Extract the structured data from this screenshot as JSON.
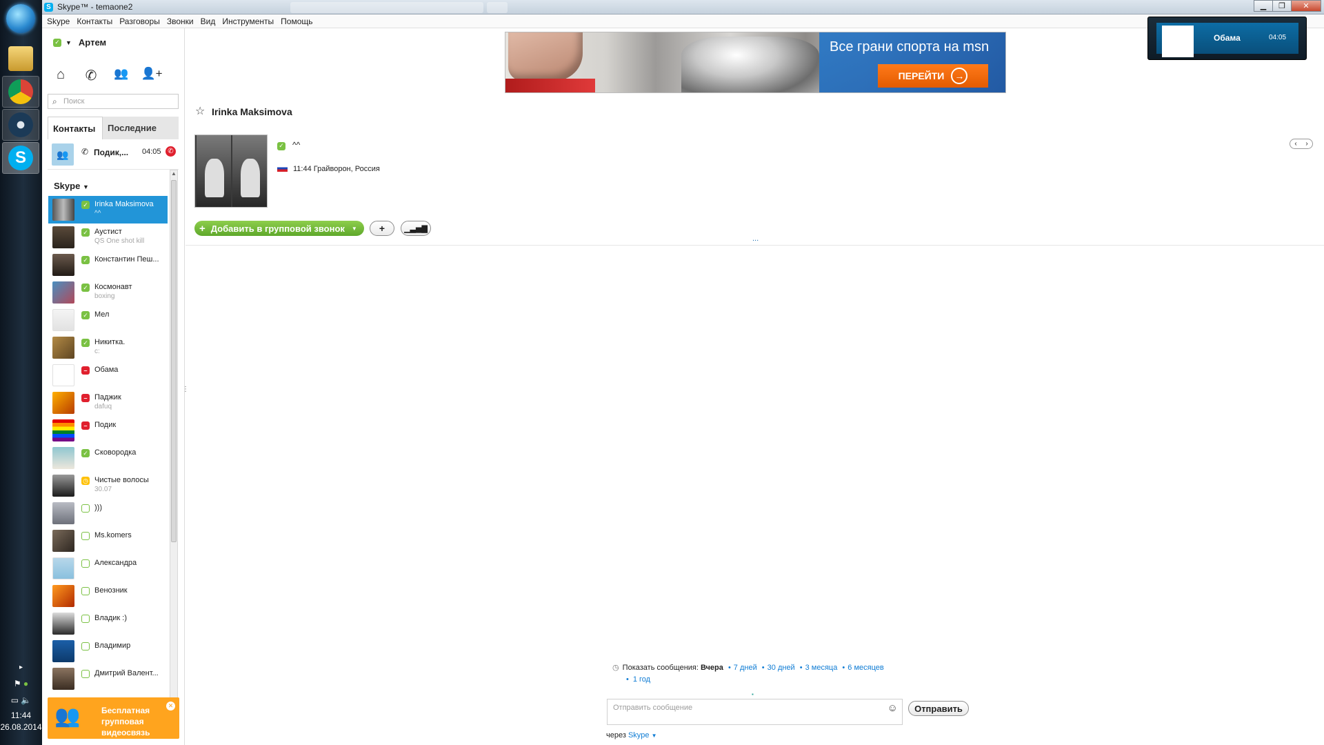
{
  "window": {
    "title": "Skype™ - temaone2"
  },
  "menu": [
    "Skype",
    "Контакты",
    "Разговоры",
    "Звонки",
    "Вид",
    "Инструменты",
    "Помощь"
  ],
  "profile": {
    "name": "Артем"
  },
  "search": {
    "placeholder": "Поиск"
  },
  "tabs": {
    "contacts": "Контакты",
    "recent": "Последние"
  },
  "recent_call": {
    "name": "Подик,...",
    "time": "04:05"
  },
  "list_header": "Skype",
  "contacts": [
    {
      "name": "Irinka Maksimova",
      "status": "^^",
      "presence": "on"
    },
    {
      "name": "Аустист",
      "status": "QS One shot kill",
      "presence": "on"
    },
    {
      "name": "Константин Пеш...",
      "status": "",
      "presence": "on"
    },
    {
      "name": "Космонавт",
      "status": "boxing",
      "presence": "on"
    },
    {
      "name": "Мел",
      "status": "",
      "presence": "on"
    },
    {
      "name": "Никитка.",
      "status": "c:",
      "presence": "on"
    },
    {
      "name": "Обама",
      "status": "",
      "presence": "off"
    },
    {
      "name": "Паджик",
      "status": "dafuq",
      "presence": "off"
    },
    {
      "name": "Подик",
      "status": "",
      "presence": "off"
    },
    {
      "name": "Сковородка",
      "status": "",
      "presence": "on"
    },
    {
      "name": "Чистые волосы",
      "status": "30.07",
      "presence": "away"
    },
    {
      "name": ")))",
      "status": "",
      "presence": "offline"
    },
    {
      "name": "Ms.komers",
      "status": "",
      "presence": "offline"
    },
    {
      "name": "Александра",
      "status": "",
      "presence": "offline"
    },
    {
      "name": "Венозник",
      "status": "",
      "presence": "offline"
    },
    {
      "name": "Владик :)",
      "status": "",
      "presence": "offline"
    },
    {
      "name": "Владимир",
      "status": "",
      "presence": "offline"
    },
    {
      "name": "Дмитрий Валент...",
      "status": "",
      "presence": "offline"
    }
  ],
  "promo": {
    "text": "Бесплатная групповая видеосвязь"
  },
  "ad": {
    "headline": "Все грани спорта на msn",
    "button": "ПЕРЕЙТИ"
  },
  "call_window": {
    "name": "Обама",
    "time": "04:05"
  },
  "chat": {
    "contact_name": "Irinka Maksimova",
    "mood": "^^",
    "local_time_location": "11:44 Грайворон, Россия",
    "add_to_group_call": "Добавить в групповой звонок",
    "ellipsis": "...",
    "history_label": "Показать сообщения:",
    "history_selected": "Вчера",
    "history_options": [
      "7 дней",
      "30 дней",
      "3 месяца",
      "6 месяцев",
      "1 год"
    ],
    "message_placeholder": "Отправить сообщение",
    "send": "Отправить",
    "via_label": "через",
    "via_link": "Skype"
  },
  "tray": {
    "time": "11:44",
    "date": "26.08.2014"
  },
  "colors": {
    "skype_blue": "#00aff0",
    "selection_blue": "#2295d8",
    "online_green": "#7ac143",
    "busy_red": "#e0202e",
    "away_yellow": "#ffc107",
    "promo_orange": "#ffa41e",
    "link_blue": "#0f7cd4"
  }
}
